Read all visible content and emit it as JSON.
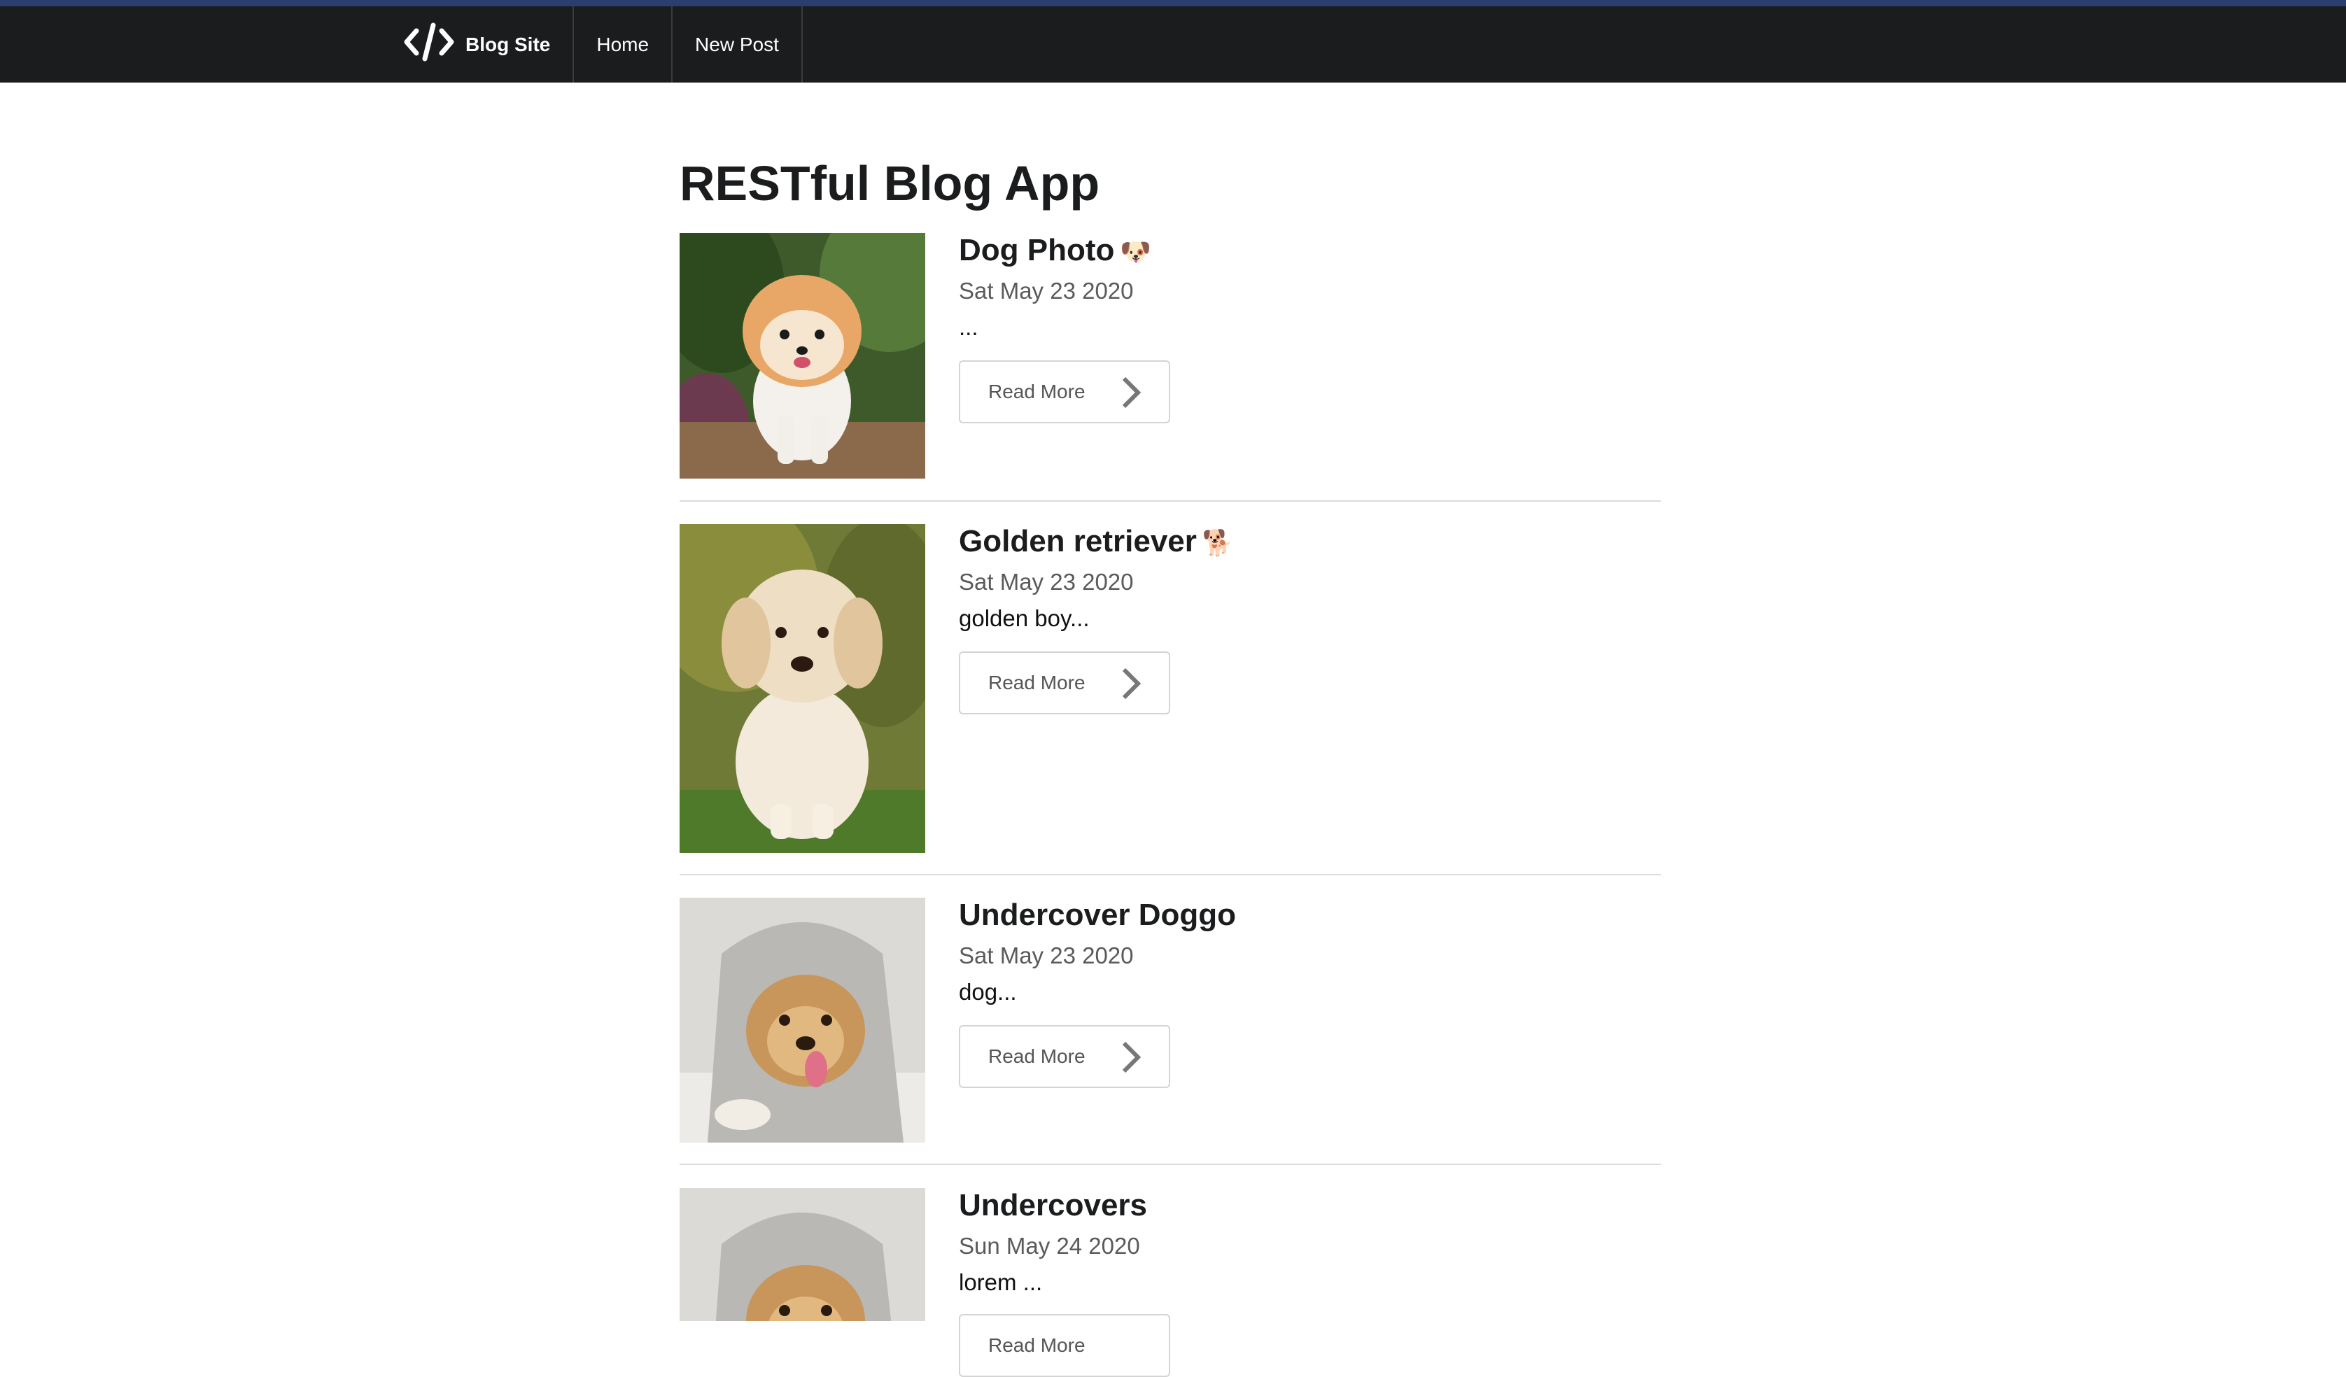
{
  "nav": {
    "brand_label": "Blog Site",
    "brand_icon": "code-icon",
    "items": [
      {
        "label": "Home"
      },
      {
        "label": "New Post"
      }
    ]
  },
  "main": {
    "title": "RESTful Blog App",
    "posts": [
      {
        "title": "Dog Photo",
        "emoji": "🐶",
        "date": "Sat May 23 2020",
        "excerpt": "...",
        "read_more": "Read More",
        "image": "pomeranian-photo"
      },
      {
        "title": "Golden retriever",
        "emoji": "🐕",
        "date": "Sat May 23 2020",
        "excerpt": "golden boy...",
        "read_more": "Read More",
        "image": "golden-puppy-photo"
      },
      {
        "title": "Undercover Doggo",
        "emoji": "",
        "date": "Sat May 23 2020",
        "excerpt": "dog...",
        "read_more": "Read More",
        "image": "dog-under-blanket-photo"
      },
      {
        "title": "Undercovers",
        "emoji": "",
        "date": "Sun May 24 2020",
        "excerpt": "lorem ...",
        "read_more": "Read More",
        "image": "dog-under-blanket-photo"
      }
    ]
  },
  "colors": {
    "navbar_bg": "#1b1c1d",
    "navbar_accent": "#2c3e6b",
    "text": "#1b1c1d",
    "meta": "#5a5a5a",
    "border": "#d4d4d5"
  }
}
